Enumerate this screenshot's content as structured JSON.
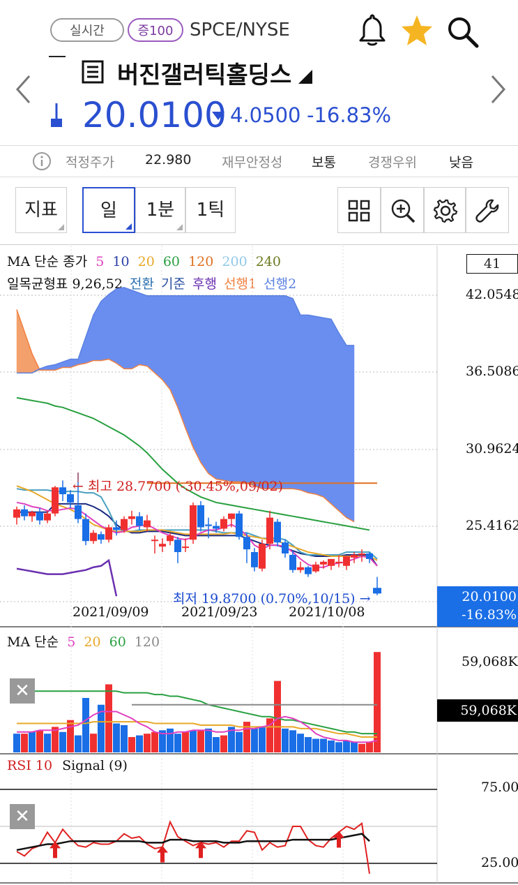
{
  "header": {
    "realtime_label": "실시간",
    "margin_label": "증100",
    "ticker": "SPCE/NYSE",
    "stock_name": "버진갤러틱홀딩스",
    "price": "20.0100",
    "change": "4.0500",
    "change_pct": "-16.83%"
  },
  "info_bar": {
    "fair_price_label": "적정주가",
    "fair_price_value": "22.980",
    "financial_label": "재무안정성",
    "financial_value": "보통",
    "competitive_label": "경쟁우위",
    "competitive_value": "낮음"
  },
  "toolbar": {
    "indicator_label": "지표",
    "period_day": "일",
    "period_1min": "1분",
    "period_tick": "1틱"
  },
  "colors": {
    "up": "#f03030",
    "down": "#1a6ee6",
    "cloud": "#6a8ef0",
    "cloud_orange": "#f3a06c",
    "ma5": "#e040c0",
    "ma20": "#e8a828",
    "ma60": "#28a040",
    "ma120": "#888888"
  },
  "price_panel": {
    "ma_legend_title": "MA 단순 종가",
    "ma_periods": [
      "5",
      "10",
      "20",
      "60",
      "120",
      "200",
      "240"
    ],
    "ichimoku_title": "일목균형표 9,26,52",
    "ichimoku_lines": [
      "전환",
      "기준",
      "후행",
      "선행1",
      "선행2"
    ],
    "box_value": "41",
    "y_ticks": [
      "42.0548",
      "36.5086",
      "30.9624",
      "25.4162"
    ],
    "last_price": "20.0100",
    "last_change_pct": "-16.83%",
    "high_annotation": "← 최고 28.7700 (-30.45%,09/02)",
    "low_annotation": "최저 19.8700 (0.70%,10/15) →",
    "x_ticks": [
      "2021/09/09",
      "2021/09/23",
      "2021/10/08"
    ]
  },
  "volume_panel": {
    "legend_title": "MA 단순",
    "ma_periods": [
      "5",
      "20",
      "60",
      "120"
    ],
    "y_tick": "59,068K",
    "current_value": "59,068K"
  },
  "rsi_panel": {
    "title": "RSI 10",
    "signal": "Signal (9)",
    "y_ticks": [
      "75.00",
      "25.00"
    ]
  },
  "chart_data": [
    {
      "type": "candlestick",
      "title": "",
      "ylim": [
        19.0,
        42.5
      ],
      "candles": [
        {
          "o": 25.5,
          "h": 26.3,
          "c": 26.1,
          "l": 25.0
        },
        {
          "o": 26.1,
          "h": 26.4,
          "c": 25.6,
          "l": 25.3
        },
        {
          "o": 25.6,
          "h": 26.0,
          "c": 25.9,
          "l": 25.2
        },
        {
          "o": 25.9,
          "h": 26.2,
          "c": 25.3,
          "l": 25.0
        },
        {
          "o": 25.3,
          "h": 26.0,
          "c": 25.8,
          "l": 25.1
        },
        {
          "o": 25.8,
          "h": 27.8,
          "c": 27.7,
          "l": 25.6
        },
        {
          "o": 27.7,
          "h": 28.2,
          "c": 27.2,
          "l": 26.7
        },
        {
          "o": 27.2,
          "h": 27.5,
          "c": 26.6,
          "l": 26.2
        },
        {
          "o": 26.4,
          "h": 28.77,
          "c": 25.4,
          "l": 25.1
        },
        {
          "o": 25.4,
          "h": 25.8,
          "c": 23.8,
          "l": 23.5
        },
        {
          "o": 23.8,
          "h": 24.6,
          "c": 24.4,
          "l": 23.6
        },
        {
          "o": 24.3,
          "h": 24.5,
          "c": 23.9,
          "l": 23.6
        },
        {
          "o": 23.9,
          "h": 25.0,
          "c": 24.8,
          "l": 23.7
        },
        {
          "o": 24.8,
          "h": 25.3,
          "c": 24.6,
          "l": 24.2
        },
        {
          "o": 24.6,
          "h": 25.6,
          "c": 25.4,
          "l": 24.4
        },
        {
          "o": 25.4,
          "h": 26.0,
          "c": 25.6,
          "l": 25.0
        },
        {
          "o": 25.6,
          "h": 25.9,
          "c": 24.9,
          "l": 24.6
        },
        {
          "o": 24.8,
          "h": 25.7,
          "c": 25.3,
          "l": 24.5
        },
        {
          "o": 23.9,
          "h": 24.2,
          "c": 23.9,
          "l": 22.9
        },
        {
          "o": 23.4,
          "h": 24.0,
          "c": 23.6,
          "l": 23.0
        },
        {
          "o": 23.8,
          "h": 24.4,
          "c": 24.2,
          "l": 23.5
        },
        {
          "o": 23.9,
          "h": 24.1,
          "c": 23.0,
          "l": 22.2
        },
        {
          "o": 23.4,
          "h": 24.0,
          "c": 23.4,
          "l": 23.0
        },
        {
          "o": 23.9,
          "h": 26.6,
          "c": 26.4,
          "l": 23.6
        },
        {
          "o": 26.4,
          "h": 26.7,
          "c": 24.8,
          "l": 24.5
        },
        {
          "o": 25.0,
          "h": 25.5,
          "c": 24.9,
          "l": 24.0
        },
        {
          "o": 24.9,
          "h": 25.2,
          "c": 24.7,
          "l": 24.4
        },
        {
          "o": 24.7,
          "h": 25.6,
          "c": 25.4,
          "l": 24.5
        },
        {
          "o": 25.4,
          "h": 25.8,
          "c": 25.8,
          "l": 24.8
        },
        {
          "o": 25.8,
          "h": 26.0,
          "c": 24.1,
          "l": 23.9
        },
        {
          "o": 24.1,
          "h": 24.4,
          "c": 23.2,
          "l": 22.2
        },
        {
          "o": 23.0,
          "h": 23.3,
          "c": 21.9,
          "l": 21.6
        },
        {
          "o": 21.8,
          "h": 23.9,
          "c": 23.6,
          "l": 21.6
        },
        {
          "o": 23.6,
          "h": 26.0,
          "c": 25.5,
          "l": 23.2
        },
        {
          "o": 25.2,
          "h": 25.4,
          "c": 23.7,
          "l": 23.4
        },
        {
          "o": 23.7,
          "h": 23.9,
          "c": 22.9,
          "l": 22.6
        },
        {
          "o": 22.8,
          "h": 23.1,
          "c": 21.7,
          "l": 21.5
        },
        {
          "o": 21.7,
          "h": 22.3,
          "c": 21.9,
          "l": 21.5
        },
        {
          "o": 21.9,
          "h": 22.0,
          "c": 21.4,
          "l": 21.2
        },
        {
          "o": 21.6,
          "h": 22.3,
          "c": 22.1,
          "l": 21.5
        },
        {
          "o": 22.1,
          "h": 22.4,
          "c": 22.3,
          "l": 21.8
        },
        {
          "o": 22.0,
          "h": 22.5,
          "c": 22.5,
          "l": 21.7
        },
        {
          "o": 22.3,
          "h": 22.8,
          "c": 22.3,
          "l": 21.9
        },
        {
          "o": 22.0,
          "h": 22.7,
          "c": 22.7,
          "l": 21.7
        },
        {
          "o": 22.6,
          "h": 23.0,
          "c": 22.8,
          "l": 22.2
        },
        {
          "o": 22.8,
          "h": 23.2,
          "c": 22.9,
          "l": 22.3
        },
        {
          "o": 22.9,
          "h": 23.0,
          "c": 22.5,
          "l": 22.2
        },
        {
          "o": 20.4,
          "h": 21.2,
          "c": 20.01,
          "l": 19.87
        }
      ],
      "ma_fast": [
        26.6,
        26.5,
        26.3,
        26.2,
        26.0,
        26.0,
        26.1,
        26.2,
        26.1,
        25.7,
        25.3,
        24.9,
        24.6,
        24.4,
        24.5,
        24.8,
        24.9,
        25.0,
        24.7,
        24.4,
        24.2,
        24.0,
        23.9,
        24.1,
        24.4,
        24.6,
        24.6,
        24.8,
        25.0,
        24.7,
        24.2,
        23.5,
        23.2,
        23.5,
        23.5,
        23.4,
        23.0,
        22.5,
        22.1,
        21.9,
        21.9,
        22.1,
        22.2,
        22.3,
        22.5,
        22.7,
        22.6,
        22.0
      ],
      "ma_mid": [
        27.8,
        27.6,
        27.4,
        27.1,
        26.8,
        26.5,
        26.3,
        26.1,
        25.8,
        25.4,
        25.0,
        24.8,
        24.6,
        24.5,
        24.5,
        24.5,
        24.5,
        24.6,
        24.6,
        24.6,
        24.5,
        24.4,
        24.3,
        24.3,
        24.3,
        24.3,
        24.3,
        24.3,
        24.4,
        24.3,
        24.2,
        24.1,
        24.0,
        23.9,
        23.8,
        23.6,
        23.4,
        23.2,
        23.0,
        22.9,
        22.8,
        22.7,
        22.7,
        22.7,
        22.7,
        22.7,
        22.7,
        22.4
      ],
      "ma_long": [
        34.2,
        34.1,
        34.0,
        33.9,
        33.8,
        33.6,
        33.5,
        33.3,
        33.1,
        32.9,
        32.7,
        32.4,
        32.1,
        31.8,
        31.5,
        31.1,
        30.7,
        30.2,
        29.6,
        29.0,
        28.5,
        28.0,
        27.6,
        27.3,
        27.0,
        26.8,
        26.6,
        26.5,
        26.4,
        26.3,
        26.2,
        26.1,
        26.0,
        25.9,
        25.8,
        25.7,
        25.6,
        25.5,
        25.4,
        25.3,
        25.2,
        25.1,
        25.0,
        24.9,
        24.8,
        24.7,
        24.6
      ],
      "ichimoku_conversion": [
        27.6,
        27.5,
        27.5,
        27.5,
        27.5,
        27.4,
        27.4,
        27.4,
        27.4,
        27.3,
        27.3,
        27.0,
        26.0,
        24.8,
        24.5,
        24.5,
        24.6,
        24.6,
        24.6,
        24.6,
        24.6,
        24.6,
        24.6,
        24.6,
        24.6,
        24.6,
        24.5,
        24.4,
        24.4,
        24.4,
        24.4,
        24.2,
        24.0,
        24.0,
        24.0,
        23.9,
        23.5,
        23.0,
        22.8,
        22.8,
        22.8,
        22.8,
        22.8,
        23.0,
        23.0,
        23.0,
        23.0,
        22.5
      ],
      "ichimoku_base": [
        25.9,
        25.9,
        25.9,
        25.9,
        25.9,
        26.5,
        26.5,
        26.5,
        26.5,
        26.5,
        26.3,
        26.0,
        25.6,
        25.0,
        24.6,
        24.4,
        24.4,
        24.5,
        24.5,
        24.5,
        24.4,
        24.3,
        24.2,
        24.2,
        24.2,
        24.2,
        24.2,
        24.2,
        24.2,
        24.2,
        24.0,
        23.8,
        23.6,
        23.5,
        23.5,
        23.3,
        23.1,
        22.9,
        22.8,
        22.7,
        22.7,
        22.7,
        22.7,
        22.8,
        22.8,
        22.8,
        22.8,
        22.0
      ],
      "ichimoku_lagging": [
        21.8,
        21.7,
        21.6,
        21.5,
        21.4,
        21.4,
        21.4,
        21.5,
        21.6,
        21.7,
        21.9,
        22.0,
        22.4,
        19.8
      ],
      "ichimoku_span_a": [
        40.6,
        39.0,
        37.4,
        36.2,
        36.2,
        36.2,
        36.4,
        36.4,
        36.6,
        36.7,
        36.9,
        36.9,
        37.0,
        36.7,
        36.3,
        36.3,
        36.6,
        36.5,
        36.0,
        35.5,
        34.8,
        33.5,
        32.0,
        30.6,
        29.5,
        28.7,
        28.3,
        28.2,
        28.1,
        28.1,
        28.0,
        27.8,
        27.6,
        27.6,
        27.6,
        27.6,
        27.6,
        27.5,
        27.3,
        27.2,
        27.0,
        26.5,
        26.0,
        25.5,
        25.2
      ],
      "ichimoku_span_b": [
        36.0,
        36.0,
        36.0,
        36.3,
        36.5,
        36.6,
        36.8,
        37.0,
        37.0,
        38.6,
        40.2,
        41.2,
        41.7,
        42.1,
        42.2,
        42.0,
        41.8,
        41.6,
        41.6,
        41.6,
        41.6,
        41.6,
        41.6,
        41.6,
        41.6,
        41.6,
        41.6,
        41.6,
        41.6,
        41.6,
        41.6,
        41.6,
        41.6,
        41.6,
        41.6,
        41.6,
        41.4,
        40.2,
        40.2,
        40.1,
        40.0,
        39.9,
        38.9,
        38.0,
        38.0
      ],
      "flat_line": 28.0,
      "high": 28.77,
      "low": 19.87
    },
    {
      "type": "bar",
      "title": "",
      "ylim": [
        0,
        59068
      ],
      "up": [
        false,
        true,
        false,
        true,
        false,
        true,
        false,
        true,
        false,
        false,
        true,
        false,
        true,
        false,
        false,
        true,
        false,
        true,
        true,
        false,
        false,
        false,
        true,
        false,
        true,
        false,
        false,
        true,
        false,
        false,
        true,
        false,
        false,
        true,
        true,
        false,
        false,
        false,
        false,
        false,
        false,
        false,
        false,
        false,
        false,
        true,
        true,
        true
      ],
      "values": [
        11,
        11,
        12,
        13,
        11,
        15,
        12,
        19,
        10,
        32,
        11,
        28,
        40,
        17,
        16,
        9,
        10,
        11,
        12,
        13,
        14,
        11,
        12,
        13,
        13,
        14,
        9,
        10,
        15,
        12,
        18,
        14,
        15,
        20,
        42,
        14,
        13,
        11,
        9,
        8,
        8,
        7,
        6,
        7,
        6,
        5,
        6,
        59
      ],
      "ma_short": [
        12,
        12,
        12,
        13,
        13,
        13,
        14,
        15,
        16,
        19,
        22,
        24,
        24,
        24,
        22,
        20,
        17,
        15,
        12,
        11,
        11,
        12,
        12,
        13,
        13,
        13,
        12,
        12,
        13,
        13,
        14,
        14,
        15,
        16,
        20,
        21,
        20,
        18,
        15,
        11,
        9,
        8,
        7,
        7,
        6,
        6,
        6,
        7
      ],
      "ma_mid": [
        17,
        17,
        17,
        17,
        17,
        17,
        17,
        17,
        17,
        17,
        18,
        18,
        18,
        18,
        18,
        18,
        18,
        18,
        17,
        17,
        17,
        17,
        17,
        17,
        16,
        16,
        16,
        16,
        16,
        15,
        15,
        15,
        15,
        15,
        15,
        15,
        15,
        14,
        14,
        14,
        13,
        12,
        11,
        11,
        10,
        9,
        9,
        9
      ],
      "ma_long": [
        36,
        36,
        36,
        36,
        36,
        36,
        36,
        36,
        36,
        36,
        36,
        36,
        36,
        36,
        35,
        35,
        35,
        35,
        34,
        34,
        33,
        33,
        32,
        31,
        30,
        28,
        27,
        26,
        25,
        24,
        23,
        22,
        21,
        21,
        20,
        19,
        19,
        18,
        17,
        16,
        15,
        14,
        13,
        12,
        12,
        11,
        11,
        11
      ],
      "ma_gray_level": 28
    },
    {
      "type": "line",
      "title": "",
      "ylim": [
        25,
        75
      ],
      "rsi": [
        33,
        30,
        35,
        37,
        46,
        39,
        48,
        42,
        37,
        36,
        39,
        38,
        38,
        40,
        45,
        42,
        43,
        38,
        35,
        36,
        53,
        43,
        40,
        37,
        39,
        38,
        39,
        36,
        40,
        40,
        47,
        46,
        34,
        39,
        36,
        37,
        50,
        50,
        41,
        37,
        36,
        42,
        46,
        50,
        48,
        52,
        18
      ],
      "signal": [
        34,
        35,
        36,
        37,
        38,
        38,
        39,
        40,
        40,
        40,
        40,
        40,
        40,
        40,
        40,
        40,
        40,
        39,
        39,
        39,
        41,
        41,
        41,
        40,
        40,
        40,
        40,
        39,
        39,
        39,
        40,
        40,
        40,
        40,
        40,
        40,
        41,
        41,
        41,
        41,
        41,
        41,
        42,
        43,
        44,
        45,
        40
      ],
      "arrows": [
        5,
        19,
        24,
        42
      ]
    }
  ]
}
